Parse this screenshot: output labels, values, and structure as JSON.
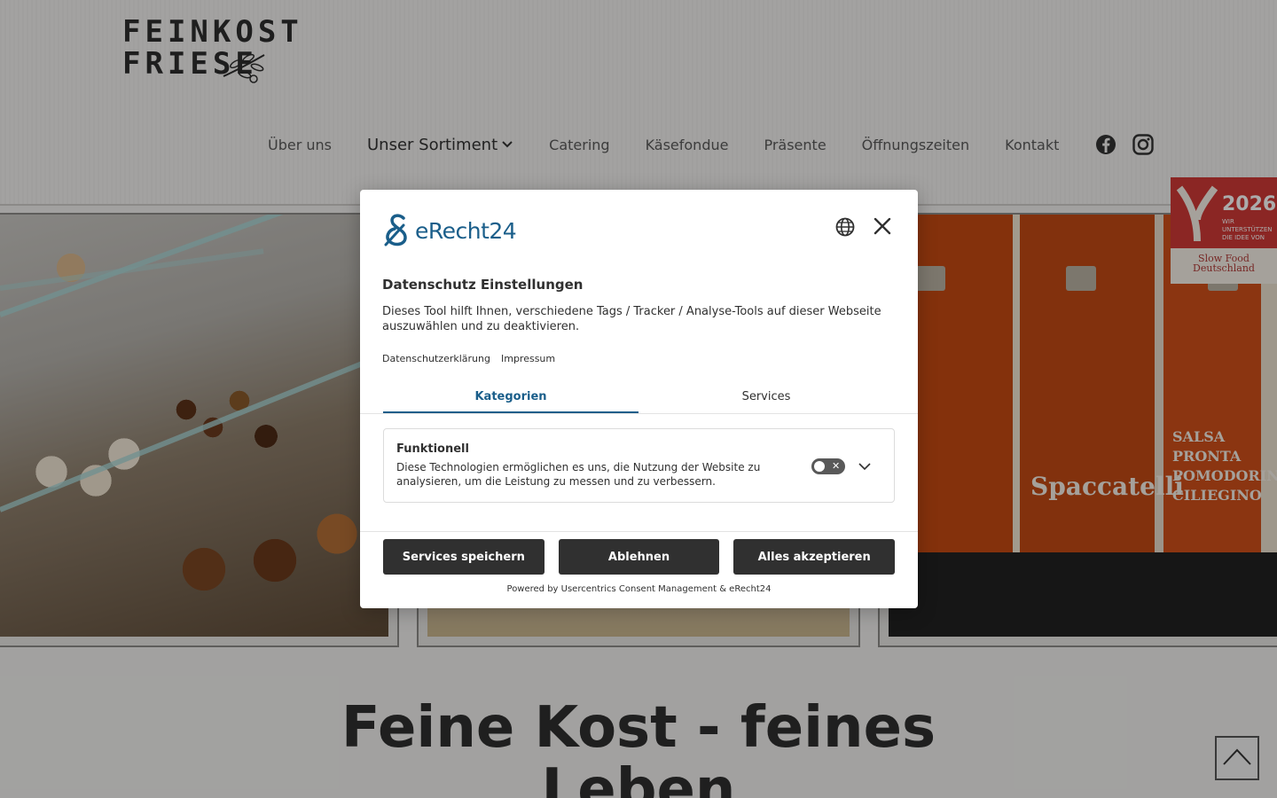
{
  "site": {
    "logo_line1": "FEINKOST",
    "logo_line2": "FRIESE",
    "nav": [
      {
        "label": "Über uns"
      },
      {
        "label": "Unser Sortiment"
      },
      {
        "label": "Catering"
      },
      {
        "label": "Käsefondue"
      },
      {
        "label": "Präsente"
      },
      {
        "label": "Öffnungszeiten"
      },
      {
        "label": "Kontakt"
      }
    ],
    "social": [
      "facebook-icon",
      "instagram-icon"
    ],
    "badge": {
      "year": "2026",
      "text": "WIR UNTERSTÜTZEN DIE IDEE VON",
      "org": "Slow Food Deutschland"
    },
    "jar_labels": [
      "Spaccatelli",
      "SALSA PRONTA POMODORINI CILIEGINO"
    ],
    "intro_heading": "Feine Kost - feines Leben"
  },
  "consent": {
    "brand": "eRecht24",
    "title": "Datenschutz Einstellungen",
    "description": "Dieses Tool hilft Ihnen, verschiedene Tags / Tracker / Analyse-Tools auf dieser Webseite auszuwählen und zu deaktivieren.",
    "links": [
      "Datenschutzerklärung",
      "Impressum"
    ],
    "tabs": [
      {
        "label": "Kategorien",
        "active": true
      },
      {
        "label": "Services",
        "active": false
      }
    ],
    "categories": [
      {
        "title": "Funktionell",
        "description": "Diese Technologien ermöglichen es uns, die Nutzung der Website zu analysieren, um die Leistung zu messen und zu verbessern.",
        "enabled": false
      }
    ],
    "buttons": {
      "save": "Services speichern",
      "deny": "Ablehnen",
      "accept": "Alles akzeptieren"
    },
    "powered_by": "Powered by Usercentrics Consent Management & eRecht24",
    "accent_color": "#1a5e8a",
    "button_color": "#303030"
  }
}
